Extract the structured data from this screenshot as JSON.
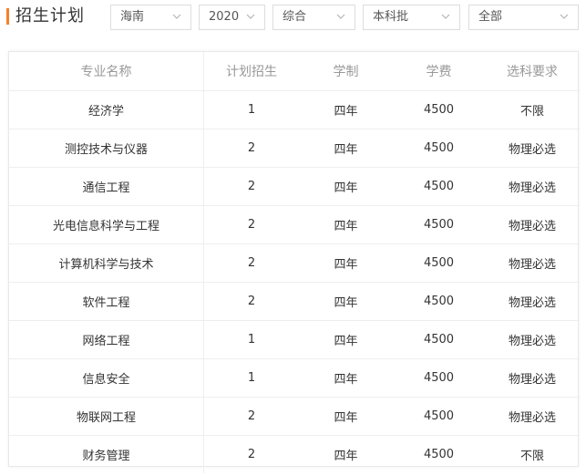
{
  "header": {
    "title": "招生计划",
    "accent_color": "#f5802a"
  },
  "filters": {
    "province": "海南",
    "year": "2020",
    "category": "综合",
    "batch": "本科批",
    "type": "全部"
  },
  "table": {
    "columns": [
      "专业名称",
      "计划招生",
      "学制",
      "学费",
      "选科要求"
    ],
    "rows": [
      [
        "经济学",
        "1",
        "四年",
        "4500",
        "不限"
      ],
      [
        "测控技术与仪器",
        "2",
        "四年",
        "4500",
        "物理必选"
      ],
      [
        "通信工程",
        "2",
        "四年",
        "4500",
        "物理必选"
      ],
      [
        "光电信息科学与工程",
        "2",
        "四年",
        "4500",
        "物理必选"
      ],
      [
        "计算机科学与技术",
        "2",
        "四年",
        "4500",
        "物理必选"
      ],
      [
        "软件工程",
        "2",
        "四年",
        "4500",
        "物理必选"
      ],
      [
        "网络工程",
        "1",
        "四年",
        "4500",
        "物理必选"
      ],
      [
        "信息安全",
        "1",
        "四年",
        "4500",
        "物理必选"
      ],
      [
        "物联网工程",
        "2",
        "四年",
        "4500",
        "物理必选"
      ],
      [
        "财务管理",
        "2",
        "四年",
        "4500",
        "不限"
      ]
    ]
  },
  "icons": {
    "filter_chevron": "chevron-down-icon"
  }
}
